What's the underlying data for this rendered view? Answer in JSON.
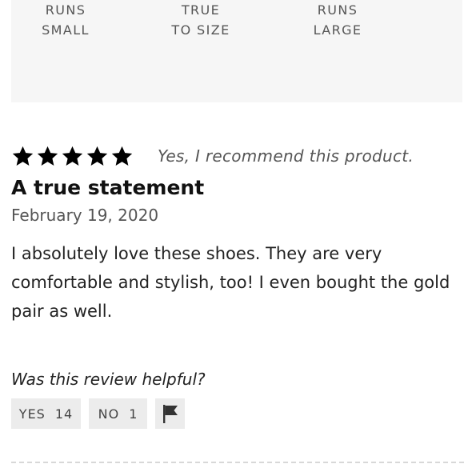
{
  "fit_scale": {
    "small": [
      "RUNS",
      "SMALL"
    ],
    "true": [
      "TRUE",
      "TO SIZE"
    ],
    "large": [
      "RUNS",
      "LARGE"
    ]
  },
  "review": {
    "rating": 5,
    "rating_max": 5,
    "recommend_text": "Yes, I recommend this product.",
    "title": "A true statement",
    "date": "February 19, 2020",
    "body": "I absolutely love these shoes. They are very comfortable and stylish, too! I even bought the gold pair as well."
  },
  "helpful": {
    "question": "Was this review helpful?",
    "yes_label": "YES",
    "yes_count": "14",
    "no_label": "NO",
    "no_count": "1",
    "flag_icon": "flag-icon"
  },
  "colors": {
    "star": "#000000",
    "panel_bg": "#f6f6f6",
    "button_bg": "#ececec"
  }
}
